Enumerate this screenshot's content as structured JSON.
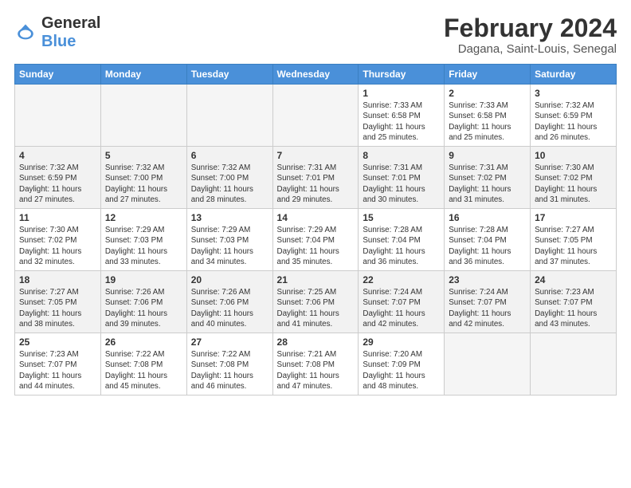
{
  "logo": {
    "text_general": "General",
    "text_blue": "Blue"
  },
  "header": {
    "title": "February 2024",
    "subtitle": "Dagana, Saint-Louis, Senegal"
  },
  "days_of_week": [
    "Sunday",
    "Monday",
    "Tuesday",
    "Wednesday",
    "Thursday",
    "Friday",
    "Saturday"
  ],
  "weeks": [
    {
      "shaded": false,
      "days": [
        {
          "num": "",
          "info": "",
          "empty": true
        },
        {
          "num": "",
          "info": "",
          "empty": true
        },
        {
          "num": "",
          "info": "",
          "empty": true
        },
        {
          "num": "",
          "info": "",
          "empty": true
        },
        {
          "num": "1",
          "info": "Sunrise: 7:33 AM\nSunset: 6:58 PM\nDaylight: 11 hours\nand 25 minutes.",
          "empty": false
        },
        {
          "num": "2",
          "info": "Sunrise: 7:33 AM\nSunset: 6:58 PM\nDaylight: 11 hours\nand 25 minutes.",
          "empty": false
        },
        {
          "num": "3",
          "info": "Sunrise: 7:32 AM\nSunset: 6:59 PM\nDaylight: 11 hours\nand 26 minutes.",
          "empty": false
        }
      ]
    },
    {
      "shaded": true,
      "days": [
        {
          "num": "4",
          "info": "Sunrise: 7:32 AM\nSunset: 6:59 PM\nDaylight: 11 hours\nand 27 minutes.",
          "empty": false
        },
        {
          "num": "5",
          "info": "Sunrise: 7:32 AM\nSunset: 7:00 PM\nDaylight: 11 hours\nand 27 minutes.",
          "empty": false
        },
        {
          "num": "6",
          "info": "Sunrise: 7:32 AM\nSunset: 7:00 PM\nDaylight: 11 hours\nand 28 minutes.",
          "empty": false
        },
        {
          "num": "7",
          "info": "Sunrise: 7:31 AM\nSunset: 7:01 PM\nDaylight: 11 hours\nand 29 minutes.",
          "empty": false
        },
        {
          "num": "8",
          "info": "Sunrise: 7:31 AM\nSunset: 7:01 PM\nDaylight: 11 hours\nand 30 minutes.",
          "empty": false
        },
        {
          "num": "9",
          "info": "Sunrise: 7:31 AM\nSunset: 7:02 PM\nDaylight: 11 hours\nand 31 minutes.",
          "empty": false
        },
        {
          "num": "10",
          "info": "Sunrise: 7:30 AM\nSunset: 7:02 PM\nDaylight: 11 hours\nand 31 minutes.",
          "empty": false
        }
      ]
    },
    {
      "shaded": false,
      "days": [
        {
          "num": "11",
          "info": "Sunrise: 7:30 AM\nSunset: 7:02 PM\nDaylight: 11 hours\nand 32 minutes.",
          "empty": false
        },
        {
          "num": "12",
          "info": "Sunrise: 7:29 AM\nSunset: 7:03 PM\nDaylight: 11 hours\nand 33 minutes.",
          "empty": false
        },
        {
          "num": "13",
          "info": "Sunrise: 7:29 AM\nSunset: 7:03 PM\nDaylight: 11 hours\nand 34 minutes.",
          "empty": false
        },
        {
          "num": "14",
          "info": "Sunrise: 7:29 AM\nSunset: 7:04 PM\nDaylight: 11 hours\nand 35 minutes.",
          "empty": false
        },
        {
          "num": "15",
          "info": "Sunrise: 7:28 AM\nSunset: 7:04 PM\nDaylight: 11 hours\nand 36 minutes.",
          "empty": false
        },
        {
          "num": "16",
          "info": "Sunrise: 7:28 AM\nSunset: 7:04 PM\nDaylight: 11 hours\nand 36 minutes.",
          "empty": false
        },
        {
          "num": "17",
          "info": "Sunrise: 7:27 AM\nSunset: 7:05 PM\nDaylight: 11 hours\nand 37 minutes.",
          "empty": false
        }
      ]
    },
    {
      "shaded": true,
      "days": [
        {
          "num": "18",
          "info": "Sunrise: 7:27 AM\nSunset: 7:05 PM\nDaylight: 11 hours\nand 38 minutes.",
          "empty": false
        },
        {
          "num": "19",
          "info": "Sunrise: 7:26 AM\nSunset: 7:06 PM\nDaylight: 11 hours\nand 39 minutes.",
          "empty": false
        },
        {
          "num": "20",
          "info": "Sunrise: 7:26 AM\nSunset: 7:06 PM\nDaylight: 11 hours\nand 40 minutes.",
          "empty": false
        },
        {
          "num": "21",
          "info": "Sunrise: 7:25 AM\nSunset: 7:06 PM\nDaylight: 11 hours\nand 41 minutes.",
          "empty": false
        },
        {
          "num": "22",
          "info": "Sunrise: 7:24 AM\nSunset: 7:07 PM\nDaylight: 11 hours\nand 42 minutes.",
          "empty": false
        },
        {
          "num": "23",
          "info": "Sunrise: 7:24 AM\nSunset: 7:07 PM\nDaylight: 11 hours\nand 42 minutes.",
          "empty": false
        },
        {
          "num": "24",
          "info": "Sunrise: 7:23 AM\nSunset: 7:07 PM\nDaylight: 11 hours\nand 43 minutes.",
          "empty": false
        }
      ]
    },
    {
      "shaded": false,
      "days": [
        {
          "num": "25",
          "info": "Sunrise: 7:23 AM\nSunset: 7:07 PM\nDaylight: 11 hours\nand 44 minutes.",
          "empty": false
        },
        {
          "num": "26",
          "info": "Sunrise: 7:22 AM\nSunset: 7:08 PM\nDaylight: 11 hours\nand 45 minutes.",
          "empty": false
        },
        {
          "num": "27",
          "info": "Sunrise: 7:22 AM\nSunset: 7:08 PM\nDaylight: 11 hours\nand 46 minutes.",
          "empty": false
        },
        {
          "num": "28",
          "info": "Sunrise: 7:21 AM\nSunset: 7:08 PM\nDaylight: 11 hours\nand 47 minutes.",
          "empty": false
        },
        {
          "num": "29",
          "info": "Sunrise: 7:20 AM\nSunset: 7:09 PM\nDaylight: 11 hours\nand 48 minutes.",
          "empty": false
        },
        {
          "num": "",
          "info": "",
          "empty": true
        },
        {
          "num": "",
          "info": "",
          "empty": true
        }
      ]
    }
  ]
}
